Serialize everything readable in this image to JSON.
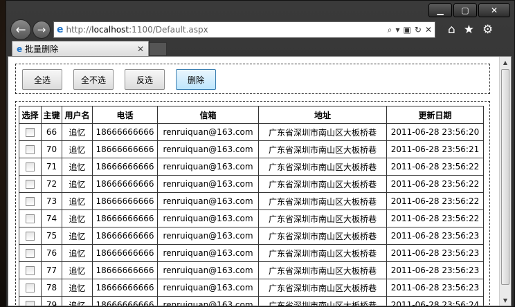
{
  "browser": {
    "url_prefix": "http://",
    "url_host": "localhost",
    "url_rest": ":1100/Default.aspx",
    "tab_title": "批量删除"
  },
  "toolbar": {
    "select_all": "全选",
    "select_none": "全不选",
    "invert": "反选",
    "delete": "删除"
  },
  "table": {
    "headers": [
      "选择",
      "主键",
      "用户名",
      "电话",
      "信箱",
      "地址",
      "更新日期"
    ],
    "rows": [
      {
        "id": "66",
        "user": "追忆",
        "phone": "18666666666",
        "email": "renruiquan@163.com",
        "address": "广东省深圳市南山区大板桥巷",
        "date": "2011-06-28 23:56:20"
      },
      {
        "id": "70",
        "user": "追忆",
        "phone": "18666666666",
        "email": "renruiquan@163.com",
        "address": "广东省深圳市南山区大板桥巷",
        "date": "2011-06-28 23:56:21"
      },
      {
        "id": "71",
        "user": "追忆",
        "phone": "18666666666",
        "email": "renruiquan@163.com",
        "address": "广东省深圳市南山区大板桥巷",
        "date": "2011-06-28 23:56:22"
      },
      {
        "id": "72",
        "user": "追忆",
        "phone": "18666666666",
        "email": "renruiquan@163.com",
        "address": "广东省深圳市南山区大板桥巷",
        "date": "2011-06-28 23:56:22"
      },
      {
        "id": "73",
        "user": "追忆",
        "phone": "18666666666",
        "email": "renruiquan@163.com",
        "address": "广东省深圳市南山区大板桥巷",
        "date": "2011-06-28 23:56:22"
      },
      {
        "id": "74",
        "user": "追忆",
        "phone": "18666666666",
        "email": "renruiquan@163.com",
        "address": "广东省深圳市南山区大板桥巷",
        "date": "2011-06-28 23:56:22"
      },
      {
        "id": "75",
        "user": "追忆",
        "phone": "18666666666",
        "email": "renruiquan@163.com",
        "address": "广东省深圳市南山区大板桥巷",
        "date": "2011-06-28 23:56:23"
      },
      {
        "id": "76",
        "user": "追忆",
        "phone": "18666666666",
        "email": "renruiquan@163.com",
        "address": "广东省深圳市南山区大板桥巷",
        "date": "2011-06-28 23:56:23"
      },
      {
        "id": "77",
        "user": "追忆",
        "phone": "18666666666",
        "email": "renruiquan@163.com",
        "address": "广东省深圳市南山区大板桥巷",
        "date": "2011-06-28 23:56:23"
      },
      {
        "id": "78",
        "user": "追忆",
        "phone": "18666666666",
        "email": "renruiquan@163.com",
        "address": "广东省深圳市南山区大板桥巷",
        "date": "2011-06-28 23:56:23"
      },
      {
        "id": "79",
        "user": "追忆",
        "phone": "18666666666",
        "email": "renruiquan@163.com",
        "address": "广东省深圳市南山区大板桥巷",
        "date": "2011-06-28 23:56:24"
      }
    ]
  },
  "colors": {
    "button_primary_border": "#3c7fb1",
    "ie_blue": "#1e73c8"
  }
}
